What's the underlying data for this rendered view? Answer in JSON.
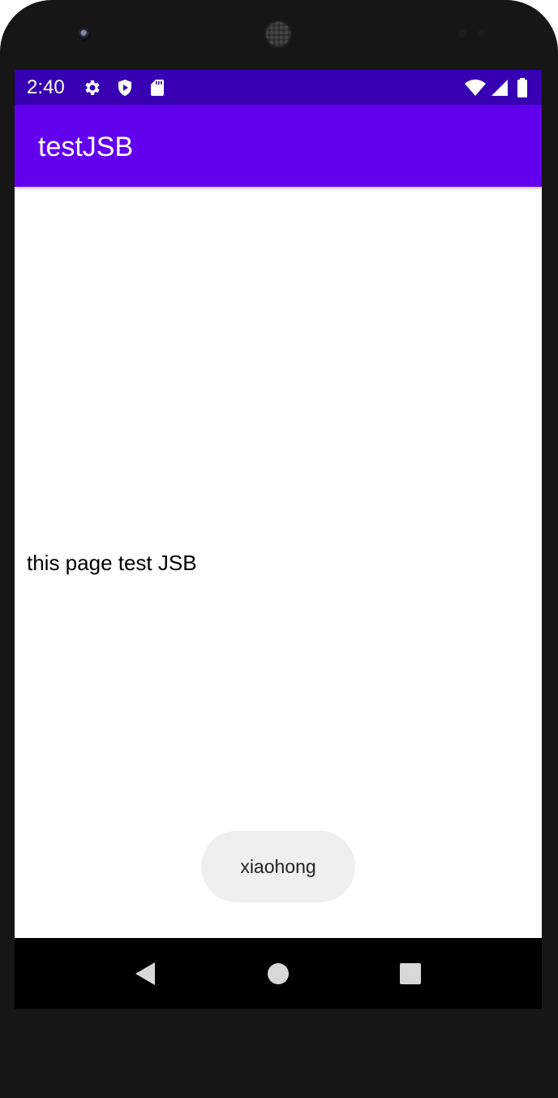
{
  "status_bar": {
    "time": "2:40",
    "left_icons": [
      "settings-icon",
      "play-protect-icon",
      "sd-card-icon"
    ],
    "right_icons": [
      "wifi-icon",
      "cell-signal-icon",
      "battery-icon"
    ],
    "background": "#3700b3"
  },
  "app_bar": {
    "title": "testJSB",
    "background": "#6200ee"
  },
  "content": {
    "text": "this page test JSB"
  },
  "toast": {
    "text": "xiaohong"
  },
  "nav_bar": {
    "buttons": [
      "back",
      "home",
      "recents"
    ]
  }
}
